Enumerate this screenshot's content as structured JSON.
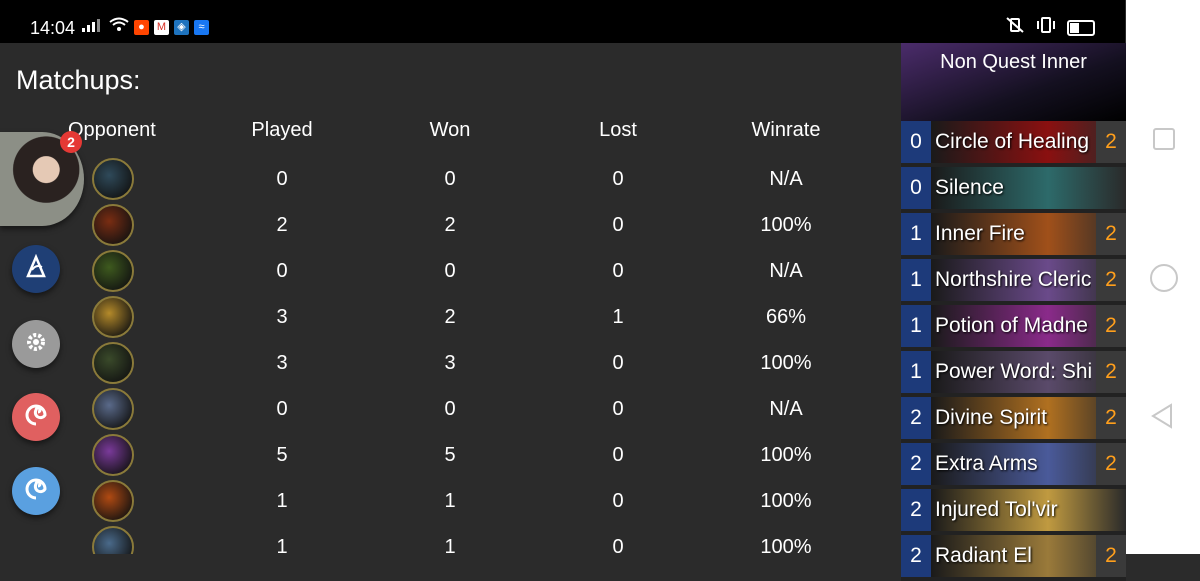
{
  "status_bar": {
    "time": "14:04"
  },
  "page_title": "Matchups:",
  "table": {
    "headers": [
      "Opponent",
      "Played",
      "Won",
      "Lost",
      "Winrate"
    ],
    "rows": [
      {
        "played": "0",
        "won": "0",
        "lost": "0",
        "winrate": "N/A",
        "color": "#2f4a5a"
      },
      {
        "played": "2",
        "won": "2",
        "lost": "0",
        "winrate": "100%",
        "color": "#7a2d12"
      },
      {
        "played": "0",
        "won": "0",
        "lost": "0",
        "winrate": "N/A",
        "color": "#3e5a1e"
      },
      {
        "played": "3",
        "won": "2",
        "lost": "1",
        "winrate": "66%",
        "color": "#b48a2a"
      },
      {
        "played": "3",
        "won": "3",
        "lost": "0",
        "winrate": "100%",
        "color": "#3a4a2a"
      },
      {
        "played": "0",
        "won": "0",
        "lost": "0",
        "winrate": "N/A",
        "color": "#5a6a8a"
      },
      {
        "played": "5",
        "won": "5",
        "lost": "0",
        "winrate": "100%",
        "color": "#7a3a9a"
      },
      {
        "played": "1",
        "won": "1",
        "lost": "0",
        "winrate": "100%",
        "color": "#b04a12"
      },
      {
        "played": "1",
        "won": "1",
        "lost": "0",
        "winrate": "100%",
        "color": "#4a6a8a"
      }
    ]
  },
  "sidebar": {
    "notification_count": "2"
  },
  "deck": {
    "name": "Non Quest Inner",
    "cards": [
      {
        "cost": "0",
        "name": "Circle of Healing",
        "count": "2",
        "art": "#8a1010"
      },
      {
        "cost": "0",
        "name": "Silence",
        "count": "",
        "art": "#2d6a6a"
      },
      {
        "cost": "1",
        "name": "Inner Fire",
        "count": "2",
        "art": "#a0501a"
      },
      {
        "cost": "1",
        "name": "Northshire Cleric",
        "count": "2",
        "art": "#6a4a8a"
      },
      {
        "cost": "1",
        "name": "Potion of Madne",
        "count": "2",
        "art": "#8a2a8a"
      },
      {
        "cost": "1",
        "name": "Power Word: Shi",
        "count": "2",
        "art": "#5a4a6a"
      },
      {
        "cost": "2",
        "name": "Divine Spirit",
        "count": "2",
        "art": "#b07020"
      },
      {
        "cost": "2",
        "name": "Extra Arms",
        "count": "2",
        "art": "#4a5a9a"
      },
      {
        "cost": "2",
        "name": "Injured Tol'vir",
        "count": "",
        "art": "#c09a40"
      },
      {
        "cost": "2",
        "name": "Radiant El",
        "count": "2",
        "art": "#9a7a3a"
      }
    ]
  }
}
